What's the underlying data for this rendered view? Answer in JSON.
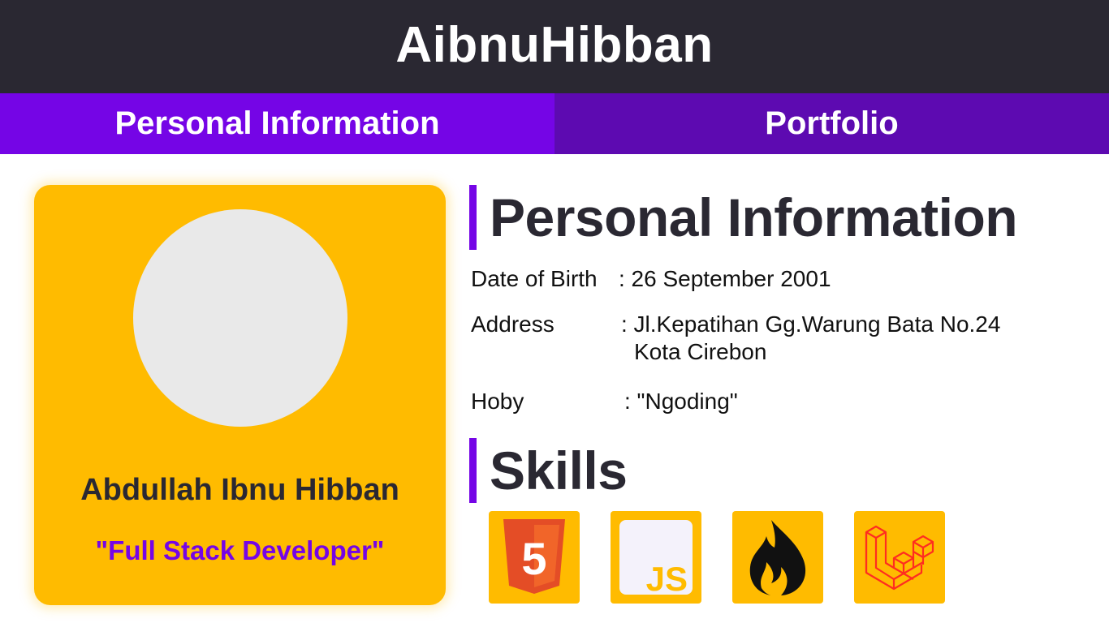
{
  "header": {
    "brand": "AibnuHibban"
  },
  "tabs": [
    {
      "label": "Personal Information",
      "active": true
    },
    {
      "label": "Portfolio",
      "active": false
    }
  ],
  "profile": {
    "name": "Abdullah Ibnu Hibban",
    "role": "\"Full Stack Developer\""
  },
  "personal": {
    "title": "Personal Information",
    "rows": [
      {
        "label": "Date of Birth",
        "value": ": 26 September 2001"
      },
      {
        "label": "Address",
        "value": ": Jl.Kepatihan Gg.Warung Bata No.24",
        "value2": "Kota Cirebon"
      },
      {
        "label": "Hoby",
        "value": ": \"Ngoding\""
      }
    ]
  },
  "skills": {
    "title": "Skills",
    "items": [
      {
        "icon": "html5-icon",
        "text": "5"
      },
      {
        "icon": "javascript-icon",
        "text": "JS"
      },
      {
        "icon": "codeigniter-icon"
      },
      {
        "icon": "laravel-icon"
      }
    ]
  },
  "colors": {
    "topbar": "#2a2832",
    "tab_active": "#7505e6",
    "tab_inactive": "#5d0ab1",
    "card": "#ffbb00",
    "accent": "#7505e6",
    "avatar": "#e9e9e9",
    "html5": "#e44d26",
    "laravel": "#ff2d20"
  }
}
